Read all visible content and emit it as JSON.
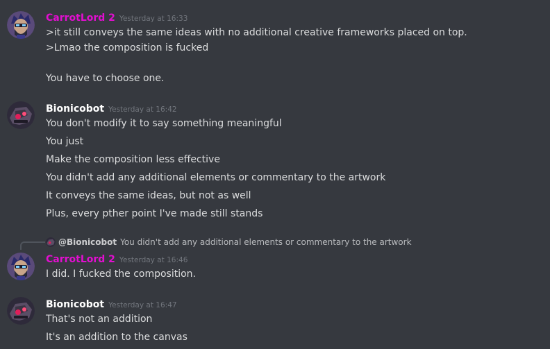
{
  "colors": {
    "background": "#36393f",
    "carrot_name": "#e20fd0",
    "bionic_name": "#ffffff",
    "message_text": "#dcddde",
    "timestamp": "#72767d"
  },
  "messages": [
    {
      "author": "CarrotLord 2",
      "timestamp": "Yesterday at 16:33",
      "avatar": "carrotlord-avatar",
      "lines": [
        ">it still conveys the same ideas with no additional creative frameworks placed on top.",
        ">Lmao the composition is fucked",
        "",
        "You have to choose one."
      ]
    },
    {
      "author": "Bionicobot",
      "timestamp": "Yesterday at 16:42",
      "avatar": "bionicobot-avatar",
      "lines": [
        "You don't modify it to say something meaningful",
        "You just",
        "Make the composition less effective",
        "You didn't add any additional elements or commentary to the artwork",
        "It conveys the same ideas, but not as well",
        "Plus, every pther point I've made still stands"
      ]
    },
    {
      "reply": {
        "mention": "@Bionicobot",
        "text": "You didn't add any additional elements or commentary to the artwork"
      },
      "author": "CarrotLord 2",
      "timestamp": "Yesterday at 16:46",
      "avatar": "carrotlord-avatar",
      "lines": [
        "I did. I fucked the composition."
      ]
    },
    {
      "author": "Bionicobot",
      "timestamp": "Yesterday at 16:47",
      "avatar": "bionicobot-avatar",
      "lines": [
        "That's not an addition",
        "It's an addition to the canvas"
      ]
    }
  ]
}
